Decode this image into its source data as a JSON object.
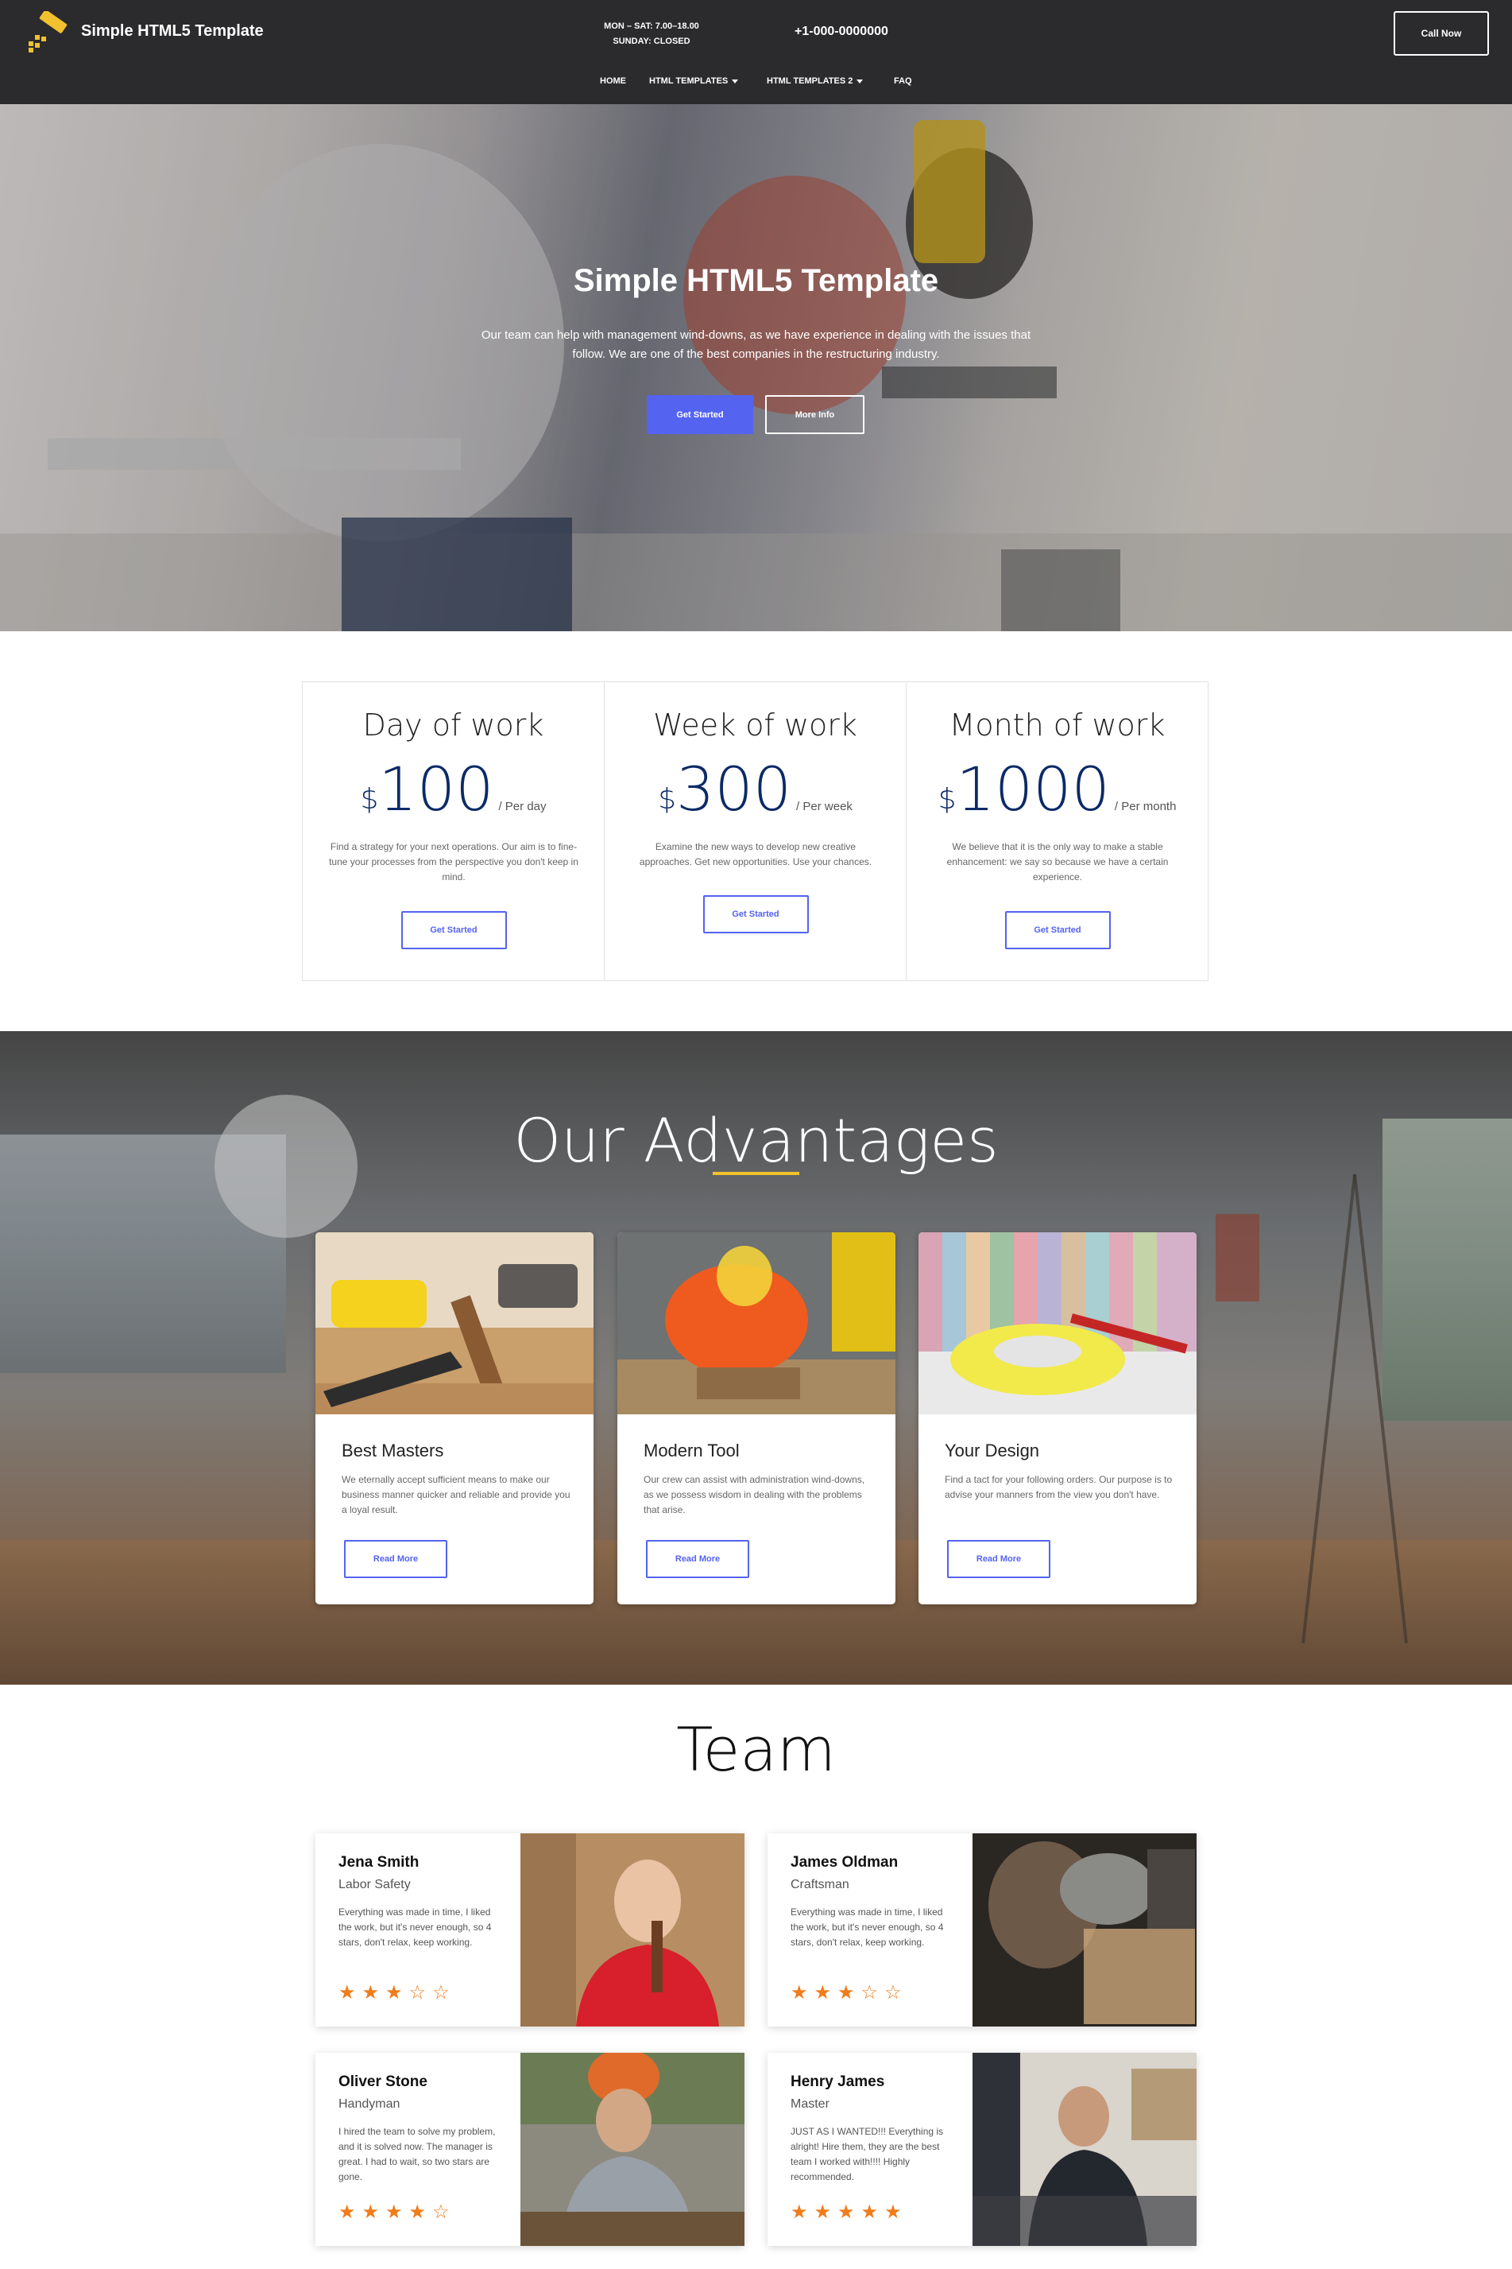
{
  "nav": {
    "brand": "Simple HTML5 Template",
    "hours_line1": "MON – SAT: 7.00–18.00",
    "hours_line2": "SUNDAY: CLOSED",
    "phone": "+1-000-0000000",
    "call_label": "Call Now",
    "menu": [
      "HOME",
      "HTML TEMPLATES",
      "HTML TEMPLATES 2",
      "FAQ"
    ]
  },
  "hero": {
    "title": "Simple HTML5 Template",
    "text": "Our team can help with management wind-downs, as we have experience in dealing with the issues that follow. We are one of the best companies in the restructuring industry.",
    "primary_label": "Get Started",
    "secondary_label": "More Info"
  },
  "pricing": [
    {
      "title": "Day of work",
      "currency": "$",
      "amount": "100",
      "period": "/ Per day",
      "desc": "Find a strategy for your next operations. Our aim is to fine-tune your processes from the perspective you don't keep in mind.",
      "button": "Get Started"
    },
    {
      "title": "Week of work",
      "currency": "$",
      "amount": "300",
      "period": "/ Per week",
      "desc": "Examine the new ways to develop new creative approaches. Get new opportunities. Use your chances.",
      "button": "Get Started"
    },
    {
      "title": "Month of work",
      "currency": "$",
      "amount": "1000",
      "period": "/ Per month",
      "desc": "We believe that it is the only way to make a stable enhancement: we say so because we have a certain experience.",
      "button": "Get Started"
    }
  ],
  "advantages": {
    "title": "Our Advantages",
    "cards": [
      {
        "title": "Best Masters",
        "desc": "We eternally accept sufficient means to make our business manner quicker and reliable and provide you a loyal result.",
        "button": "Read More"
      },
      {
        "title": "Modern Tool",
        "desc": "Our crew can assist with administration wind-downs, as we possess wisdom in dealing with the problems that arise.",
        "button": "Read More"
      },
      {
        "title": "Your Design",
        "desc": "Find a tact for your following orders. Our purpose is to advise your manners from the view you don't have.",
        "button": "Read More"
      }
    ]
  },
  "team": {
    "title": "Team",
    "members": [
      {
        "name": "Jena Smith",
        "role": "Labor Safety",
        "quote": "Everything was made in time, I liked the work, but it's never enough, so 4 stars, don't relax, keep working.",
        "rating": 3
      },
      {
        "name": "James Oldman",
        "role": "Craftsman",
        "quote": "Everything was made in time, I liked the work, but it's never enough, so 4 stars, don't relax, keep working.",
        "rating": 3
      },
      {
        "name": "Oliver Stone",
        "role": "Handyman",
        "quote": "I hired the team to solve my problem, and it is solved now. The manager is great. I had to wait, so two stars are gone.",
        "rating": 4
      },
      {
        "name": "Henry James",
        "role": "Master",
        "quote": "JUST AS I WANTED!!! Everything is alright! Hire them, they are the best team I worked with!!!! Highly recommended.",
        "rating": 5
      }
    ]
  },
  "colors": {
    "accent": "#5463f0",
    "nav_bg": "#2b2a2c",
    "star": "#f07c1a",
    "underline": "#f2c12e",
    "price": "#0c2a67"
  }
}
